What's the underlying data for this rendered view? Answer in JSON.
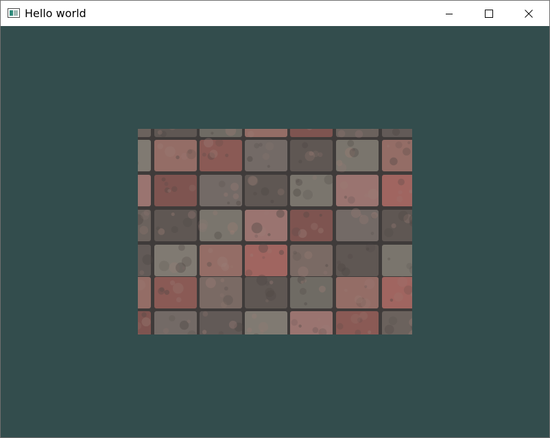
{
  "window": {
    "title": "Hello world",
    "app_icon": "app-window-icon",
    "controls": {
      "minimize_icon": "minimize-icon",
      "maximize_icon": "maximize-icon",
      "close_icon": "close-icon"
    }
  },
  "viewport": {
    "clear_color": "#334d4d",
    "content": "textured-quad",
    "texture": "brick-pavement"
  }
}
